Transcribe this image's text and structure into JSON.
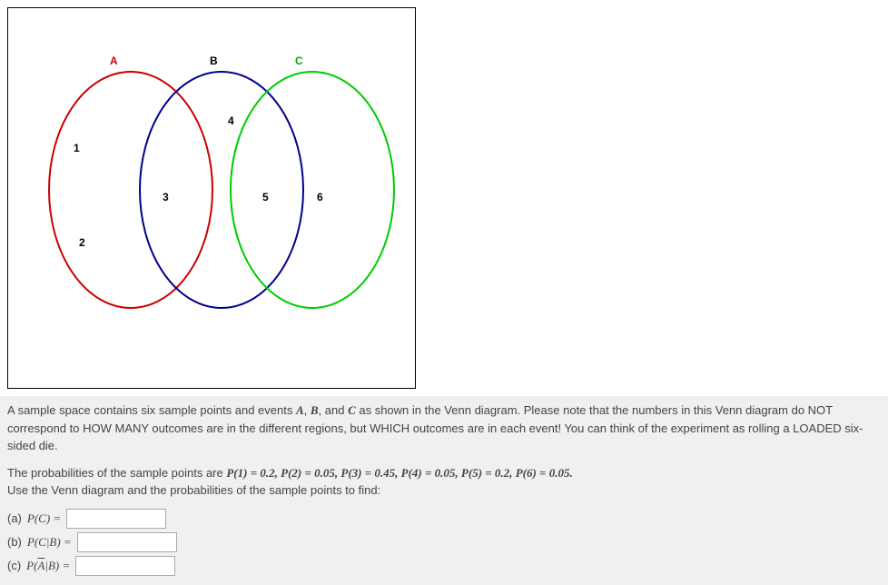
{
  "chart_data": {
    "type": "venn",
    "sets": [
      {
        "name": "A",
        "color": "#cc0000",
        "points": [
          1,
          2,
          3
        ]
      },
      {
        "name": "B",
        "color": "#00008b",
        "points": [
          3,
          4,
          5
        ]
      },
      {
        "name": "C",
        "color": "#00cc00",
        "points": [
          5,
          6
        ]
      }
    ],
    "point_labels": [
      "1",
      "2",
      "3",
      "4",
      "5",
      "6"
    ],
    "set_labels": [
      "A",
      "B",
      "C"
    ]
  },
  "intro": {
    "line1_pre": "A sample space contains six sample points and events ",
    "A": "A",
    "comma": ", ",
    "B": "B",
    "and": ", and ",
    "C": "C",
    "line1_post": " as shown in the Venn diagram. Please note that the numbers in this Venn diagram do NOT correspond to HOW MANY outcomes are in the different regions, but WHICH outcomes are in each event! You can think of the experiment as rolling a LOADED six-sided die."
  },
  "probabilities": {
    "lead": "The probabilities of the sample points are ",
    "p1": "P(1) = 0.2, ",
    "p2": "P(2) = 0.05, ",
    "p3": "P(3) = 0.45, ",
    "p4": "P(4) = 0.05, ",
    "p5": "P(5) = 0.2, ",
    "p6": "P(6) = 0.05.",
    "instruction": "Use the Venn diagram and the probabilities of the sample points to find:"
  },
  "questions": {
    "a_label": "(a)  ",
    "a_expr": "P(C) =",
    "b_label": "(b)  ",
    "b_expr": "P(C|B) =",
    "c_label": "(c)  ",
    "c_expr_pre": "P(",
    "c_expr_var": "A",
    "c_expr_post": "|B) ="
  }
}
